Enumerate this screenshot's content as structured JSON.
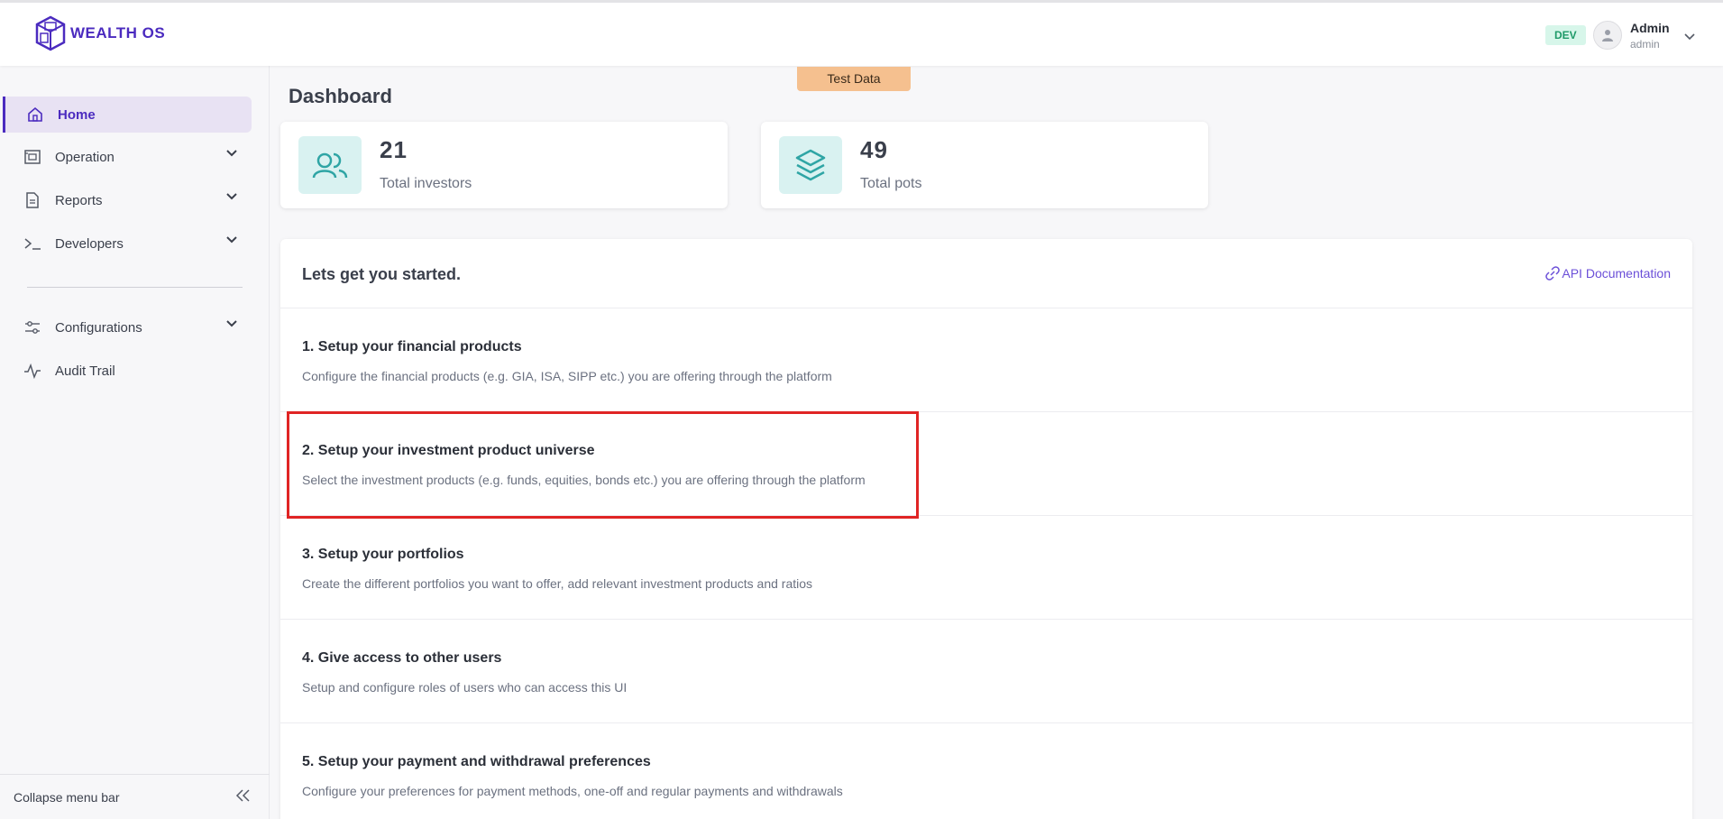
{
  "header": {
    "logo_text": "WEALTH OS",
    "env_badge": "DEV",
    "user_name": "Admin",
    "user_role": "admin"
  },
  "sidebar": {
    "items": [
      {
        "label": "Home",
        "icon": "home-icon",
        "active": true
      },
      {
        "label": "Operation",
        "icon": "operation-icon",
        "expandable": true
      },
      {
        "label": "Reports",
        "icon": "reports-icon",
        "expandable": true
      },
      {
        "label": "Developers",
        "icon": "terminal-icon",
        "expandable": true
      },
      {
        "label": "Configurations",
        "icon": "sliders-icon",
        "expandable": true
      },
      {
        "label": "Audit Trail",
        "icon": "activity-icon"
      }
    ],
    "collapse_label": "Collapse menu bar"
  },
  "main": {
    "test_data_label": "Test Data",
    "page_title": "Dashboard",
    "stats": [
      {
        "value": "21",
        "label": "Total investors",
        "icon": "users-icon"
      },
      {
        "value": "49",
        "label": "Total pots",
        "icon": "layers-icon"
      }
    ],
    "started": {
      "title": "Lets get you started.",
      "api_link": "API Documentation",
      "steps": [
        {
          "title": "1. Setup your financial products",
          "desc": "Configure the financial products (e.g. GIA, ISA, SIPP etc.) you are offering through the platform"
        },
        {
          "title": "2. Setup your investment product universe",
          "desc": "Select the investment products (e.g. funds, equities, bonds etc.) you are offering through the platform"
        },
        {
          "title": "3. Setup your portfolios",
          "desc": "Create the different portfolios you want to offer, add relevant investment products and ratios"
        },
        {
          "title": "4. Give access to other users",
          "desc": "Setup and configure roles of users who can access this UI"
        },
        {
          "title": "5. Setup your payment and withdrawal preferences",
          "desc": "Configure your preferences for payment methods, one-off and regular payments and withdrawals"
        }
      ]
    }
  },
  "colors": {
    "brand": "#4b2bbf",
    "accent_teal": "#2fa5a5",
    "highlight": "#e02424",
    "test_data_badge": "#f5c08f"
  }
}
